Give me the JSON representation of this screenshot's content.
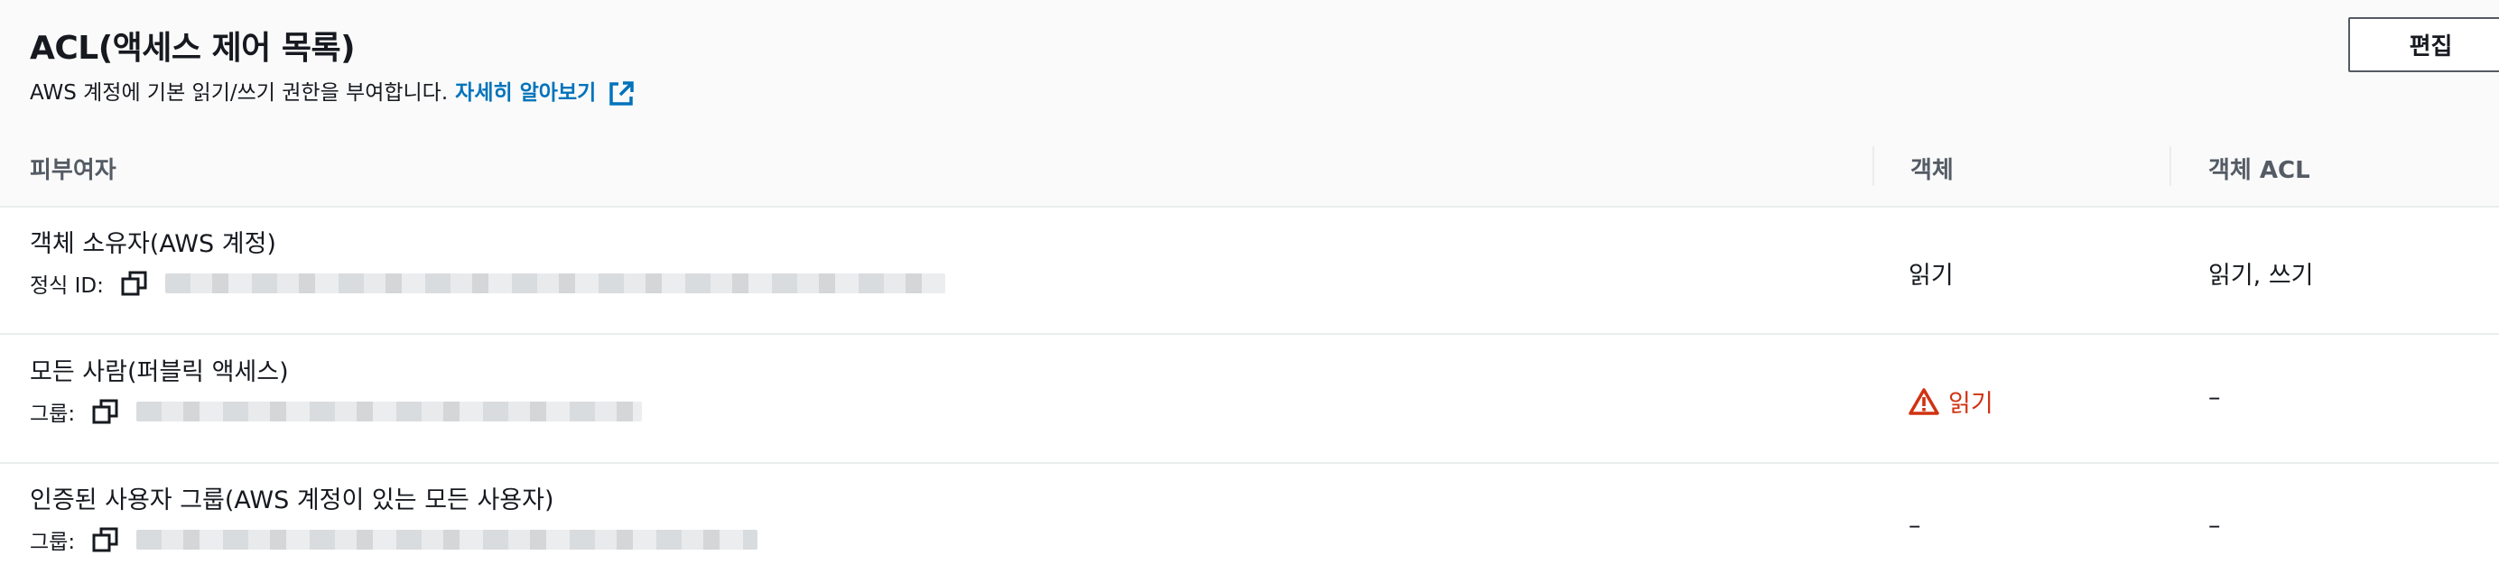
{
  "header": {
    "title": "ACL(액세스 제어 목록)",
    "description": "AWS 계정에 기본 읽기/쓰기 권한을 부여합니다.",
    "learn_more": "자세히 알아보기",
    "edit_label": "편집"
  },
  "columns": {
    "grantee": "피부여자",
    "objects": "객체",
    "object_acl": "객체 ACL"
  },
  "rows": [
    {
      "grantee": "객체 소유자(AWS 계정)",
      "id_label": "정식 ID:",
      "objects": "읽기",
      "object_acl": "읽기, 쓰기"
    },
    {
      "grantee": "모든 사람(퍼블릭 액세스)",
      "id_label": "그룹:",
      "objects": "읽기",
      "object_acl": "–"
    },
    {
      "grantee": "인증된 사용자 그룹(AWS 계정이 있는 모든 사용자)",
      "id_label": "그룹:",
      "objects": "–",
      "object_acl": "–"
    }
  ],
  "colors": {
    "link": "#0073bb",
    "warning": "#d13212",
    "border": "#eaeded"
  },
  "icons": {
    "external_link": "external-link-icon",
    "copy": "copy-icon",
    "warning": "warning-icon"
  }
}
